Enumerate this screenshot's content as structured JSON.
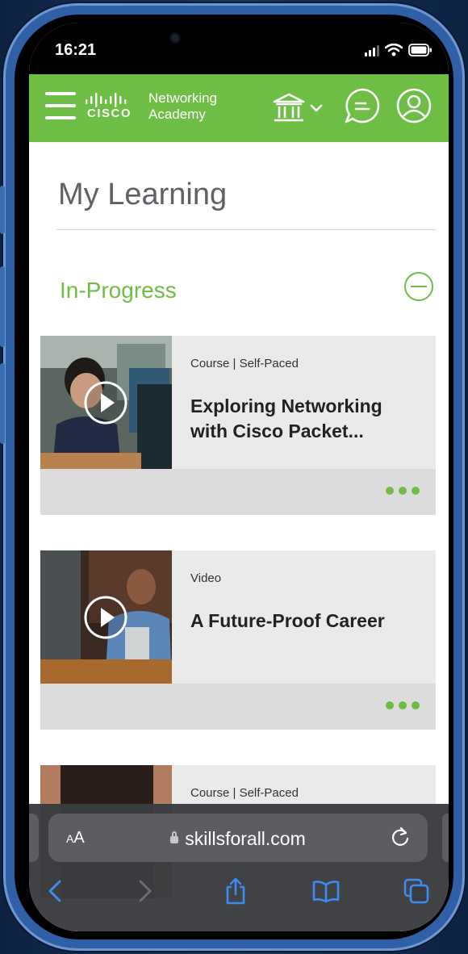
{
  "status": {
    "time": "16:21"
  },
  "header": {
    "brand_line1": "Networking",
    "brand_line2": "Academy",
    "brand_cisco": "CISCO",
    "accent": "#6ebd44"
  },
  "page": {
    "title": "My Learning",
    "section_title": "In-Progress"
  },
  "cards": [
    {
      "type": "Course | Self-Paced",
      "title": "Exploring Networking with Cisco Packet..."
    },
    {
      "type": "Video",
      "title": "A Future-Proof Career"
    },
    {
      "type": "Course | Self-Paced",
      "title": ""
    }
  ],
  "browser": {
    "text_size_label_small": "A",
    "text_size_label_large": "A",
    "url": "skillsforall.com"
  },
  "icons": [
    "menu-icon",
    "cisco-logo",
    "institution-icon",
    "chat-icon",
    "user-icon",
    "collapse-icon",
    "play-icon",
    "more-icon",
    "lock-icon",
    "reload-icon",
    "back-icon",
    "forward-icon",
    "share-icon",
    "bookmarks-icon",
    "tabs-icon"
  ]
}
